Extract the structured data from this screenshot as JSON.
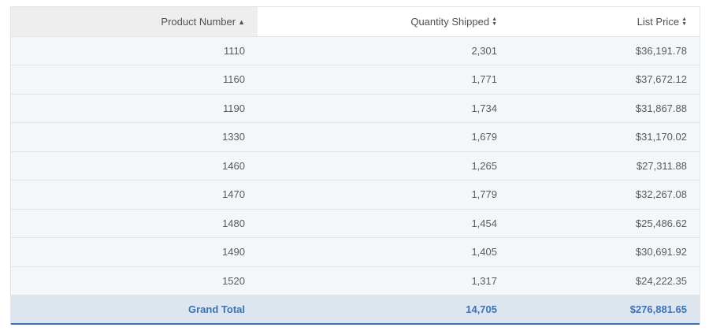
{
  "columns": [
    {
      "label": "Product Number",
      "sort": "▲"
    },
    {
      "label": "Quantity Shipped",
      "sort": "⬍"
    },
    {
      "label": "List Price",
      "sort": "⬍"
    }
  ],
  "rows": [
    {
      "product": "1110",
      "qty": "2,301",
      "price": "$36,191.78"
    },
    {
      "product": "1160",
      "qty": "1,771",
      "price": "$37,672.12"
    },
    {
      "product": "1190",
      "qty": "1,734",
      "price": "$31,867.88"
    },
    {
      "product": "1330",
      "qty": "1,679",
      "price": "$31,170.02"
    },
    {
      "product": "1460",
      "qty": "1,265",
      "price": "$27,311.88"
    },
    {
      "product": "1470",
      "qty": "1,779",
      "price": "$32,267.08"
    },
    {
      "product": "1480",
      "qty": "1,454",
      "price": "$25,486.62"
    },
    {
      "product": "1490",
      "qty": "1,405",
      "price": "$30,691.92"
    },
    {
      "product": "1520",
      "qty": "1,317",
      "price": "$24,222.35"
    }
  ],
  "total": {
    "label": "Grand Total",
    "qty": "14,705",
    "price": "$276,881.65"
  },
  "colors": {
    "accent": "#3d72b4",
    "row_bg": "#f4f7fa",
    "total_bg": "#dde6ef",
    "sorted_header_bg": "#eeeeee"
  }
}
